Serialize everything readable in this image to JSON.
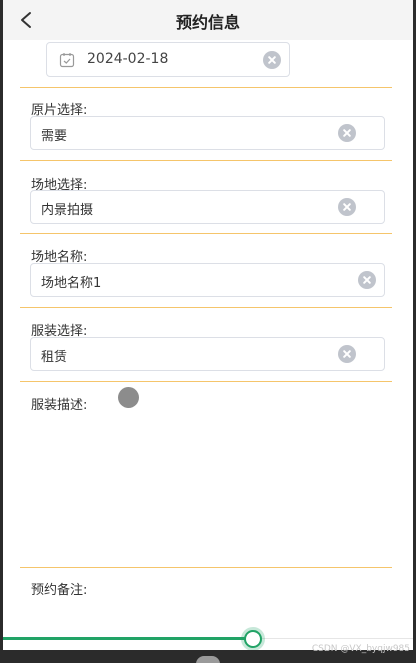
{
  "header": {
    "title": "预约信息",
    "back_icon": "chevron-left-icon"
  },
  "date_field": {
    "value": "2024-02-18",
    "icon": "calendar-icon"
  },
  "fields": [
    {
      "label": "原片选择:",
      "value": "需要"
    },
    {
      "label": "场地选择:",
      "value": "内景拍摄"
    },
    {
      "label": "场地名称:",
      "value": "场地名称1"
    },
    {
      "label": "服装选择:",
      "value": "租赁"
    }
  ],
  "costume_desc": {
    "label": "服装描述:"
  },
  "remark": {
    "label": "预约备注:"
  },
  "progress": {
    "percent": 61
  },
  "watermark": "CSDN @VX_byqjw985",
  "colors": {
    "divider": "#f5c56b",
    "progress": "#21a366",
    "clear": "#c0c4cc"
  }
}
